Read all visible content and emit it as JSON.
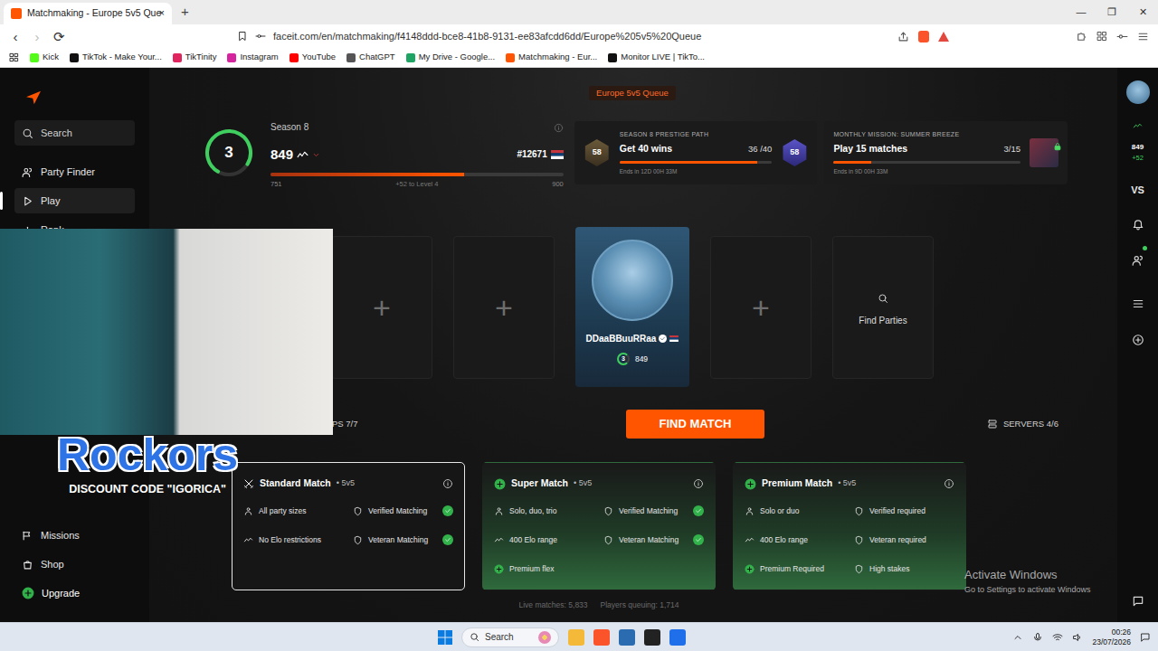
{
  "browser": {
    "tab": {
      "title": "Matchmaking - Europe 5v5 Que",
      "close": "×",
      "selected": true
    },
    "new_tab": "+",
    "window_controls": [
      "—",
      "❐",
      "✕"
    ],
    "nav": {
      "back": "‹",
      "forward": "›",
      "forward_disabled": true,
      "reload": "⟳"
    },
    "address": "faceit.com/en/matchmaking/f4148ddd-bce8-41b8-9131-ee83afcdd6dd/Europe%205v5%20Queue",
    "bookmarks": [
      {
        "label": "Kick",
        "color": "#53fc18"
      },
      {
        "label": "TikTok - Make Your...",
        "color": "#111111"
      },
      {
        "label": "TikTinity",
        "color": "#e0245e"
      },
      {
        "label": "Instagram",
        "color": "#d6249f"
      },
      {
        "label": "YouTube",
        "color": "#ff0000"
      },
      {
        "label": "ChatGPT",
        "color": "#555555"
      },
      {
        "label": "My Drive - Google...",
        "color": "#1fa463"
      },
      {
        "label": "Matchmaking - Eur...",
        "color": "#ff5500"
      },
      {
        "label": "Monitor LIVE | TikTo...",
        "color": "#111111"
      }
    ]
  },
  "sidebar": {
    "items": [
      {
        "label": "Search",
        "kind": "search",
        "selected": false
      },
      {
        "label": "Party Finder",
        "kind": "link",
        "selected": false
      },
      {
        "label": "Play",
        "kind": "link",
        "selected": true
      },
      {
        "label": "Rank",
        "kind": "link",
        "selected": false
      }
    ],
    "bottom_items": [
      {
        "label": "Missions",
        "kind": "link"
      },
      {
        "label": "Shop",
        "kind": "link"
      },
      {
        "label": "Upgrade",
        "kind": "upgrade"
      }
    ]
  },
  "webcam": {
    "overlay_title": "Rockors",
    "overlay_subtitle": "DISCOUNT CODE \"IGORICA\""
  },
  "queue": {
    "title": "Europe 5v5 Queue"
  },
  "player_stats": {
    "level": "3",
    "ring_level": 0.75,
    "season": "Season 8",
    "elo": "849",
    "rank": "#12671",
    "progress": {
      "min": "751",
      "to_next": "+52 to Level 4",
      "max": "900",
      "level": 0.66
    }
  },
  "missions": [
    {
      "kind": "season",
      "category": "SEASON 8 PRESTIGE PATH",
      "title": "Get 40 wins",
      "count": "36 /40",
      "ends": "Ends in 12D 00H 33M",
      "badge_left": "58",
      "badge_right": "58",
      "level": 0.9,
      "locked": false
    },
    {
      "kind": "monthly",
      "category": "MONTHLY MISSION: SUMMER BREEZE",
      "title": "Play 15 matches",
      "count": "3/15",
      "ends": "Ends in 9D 00H 33M",
      "level": 0.2,
      "locked": true
    }
  ],
  "party": {
    "slots": [
      {
        "kind": "empty",
        "label": "+"
      },
      {
        "kind": "empty",
        "label": "+"
      },
      {
        "kind": "player",
        "name": "DDaaBBuuRRaa",
        "verified": true,
        "level": "3",
        "elo": "849"
      },
      {
        "kind": "empty",
        "label": "+"
      },
      {
        "kind": "find",
        "label": "Find Parties"
      }
    ]
  },
  "controls": {
    "maps": "PS 7/7",
    "find_match": "FIND MATCH",
    "servers": "SERVERS 4/6"
  },
  "match_types": [
    {
      "title": "Standard Match",
      "mode": "• 5v5",
      "kind": "standard",
      "selected": true,
      "features": [
        {
          "label": "All party sizes",
          "check": false
        },
        {
          "label": "Verified Matching",
          "check": true
        },
        {
          "label": "No Elo restrictions",
          "check": false
        },
        {
          "label": "Veteran Matching",
          "check": true
        }
      ]
    },
    {
      "title": "Super Match",
      "mode": "• 5v5",
      "kind": "premium",
      "selected": false,
      "features": [
        {
          "label": "Solo, duo, trio",
          "check": false
        },
        {
          "label": "Verified Matching",
          "check": true
        },
        {
          "label": "400 Elo range",
          "check": false
        },
        {
          "label": "Veteran Matching",
          "check": true
        },
        {
          "label": "Premium flex",
          "check": false
        }
      ]
    },
    {
      "title": "Premium Match",
      "mode": "• 5v5",
      "kind": "premium",
      "selected": false,
      "features": [
        {
          "label": "Solo or duo",
          "check": false
        },
        {
          "label": "Verified required",
          "check": false
        },
        {
          "label": "400 Elo range",
          "check": false
        },
        {
          "label": "Veteran required",
          "check": false
        },
        {
          "label": "Premium Required",
          "check": false
        },
        {
          "label": "High stakes",
          "check": false
        }
      ]
    }
  ],
  "stats": [
    "Live matches: 5,833",
    "Players queuing: 1,714"
  ],
  "right_rail": {
    "elo": "849",
    "delta": "+52",
    "vs": "VS"
  },
  "watermark": {
    "title": "Activate Windows",
    "subtitle": "Go to Settings to activate Windows"
  },
  "taskbar": {
    "search": "Search",
    "time": "00:26",
    "date": "23/07/2026"
  }
}
